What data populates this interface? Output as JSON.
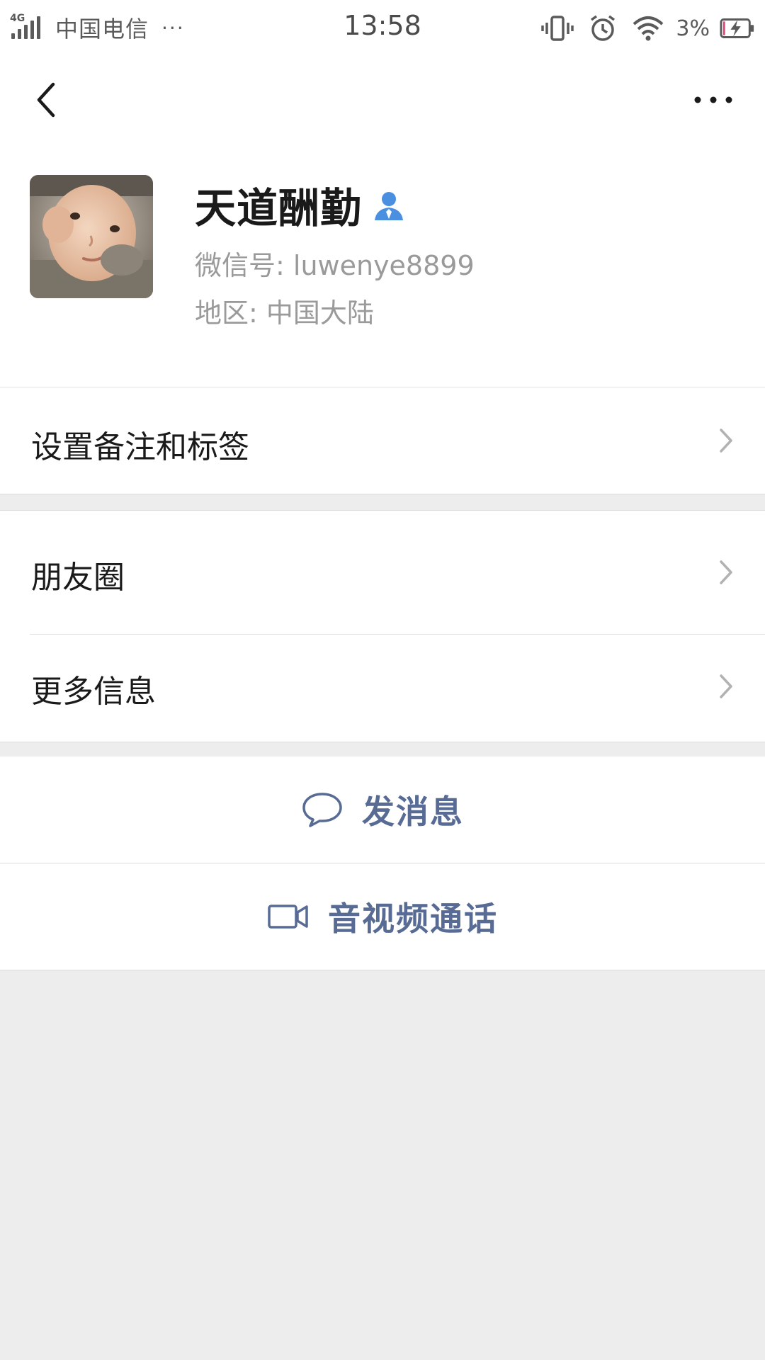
{
  "status_bar": {
    "network_gen": "4G",
    "carrier": "中国电信",
    "more": "···",
    "time": "13:58",
    "battery_percent": "3%",
    "icons": [
      "vibrate-icon",
      "alarm-icon",
      "wifi-icon",
      "battery-charging-icon"
    ]
  },
  "nav": {
    "back_icon": "back-chevron-icon",
    "more_icon": "more-dots-icon"
  },
  "profile": {
    "name": "天道酬勤",
    "gender_icon": "male-user-icon",
    "wechat_id": "微信号: luwenye8899",
    "region": "地区: 中国大陆"
  },
  "cells": {
    "remark": "设置备注和标签",
    "moments": "朋友圈",
    "more_info": "更多信息"
  },
  "actions": {
    "message": "发消息",
    "call": "音视频通话"
  },
  "colors": {
    "accent_link": "#576b95",
    "gender_icon": "#4a8fe0",
    "background": "#ededed",
    "cell": "#ffffff"
  }
}
